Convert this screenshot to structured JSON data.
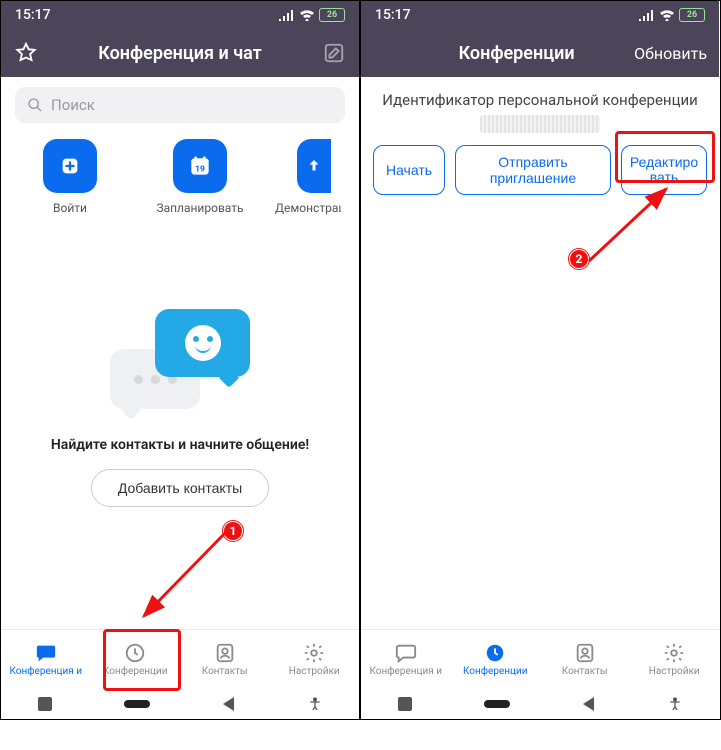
{
  "left": {
    "status": {
      "time": "15:17",
      "battery": "26"
    },
    "header": {
      "title": "Конференция и чат"
    },
    "search": {
      "placeholder": "Поиск"
    },
    "quick": {
      "join": "Войти",
      "schedule": "Запланировать",
      "schedule_day": "19",
      "share": "Демонстраци"
    },
    "empty": "Найдите контакты и начните общение!",
    "add_contacts": "Добавить контакты",
    "tabs": {
      "chat": "Конференция и",
      "meetings": "Конференции",
      "contacts": "Контакты",
      "settings": "Настройки"
    }
  },
  "right": {
    "status": {
      "time": "15:17",
      "battery": "26"
    },
    "header": {
      "title": "Конференции",
      "action": "Обновить"
    },
    "pmi_label": "Идентификатор персональной конференции",
    "buttons": {
      "start": "Начать",
      "invite": "Отправить приглашение",
      "edit_l1": "Редактиро",
      "edit_l2": "вать"
    },
    "tabs": {
      "chat": "Конференция и",
      "meetings": "Конференции",
      "contacts": "Контакты",
      "settings": "Настройки"
    }
  },
  "annotations": {
    "step1": "1",
    "step2": "2"
  }
}
